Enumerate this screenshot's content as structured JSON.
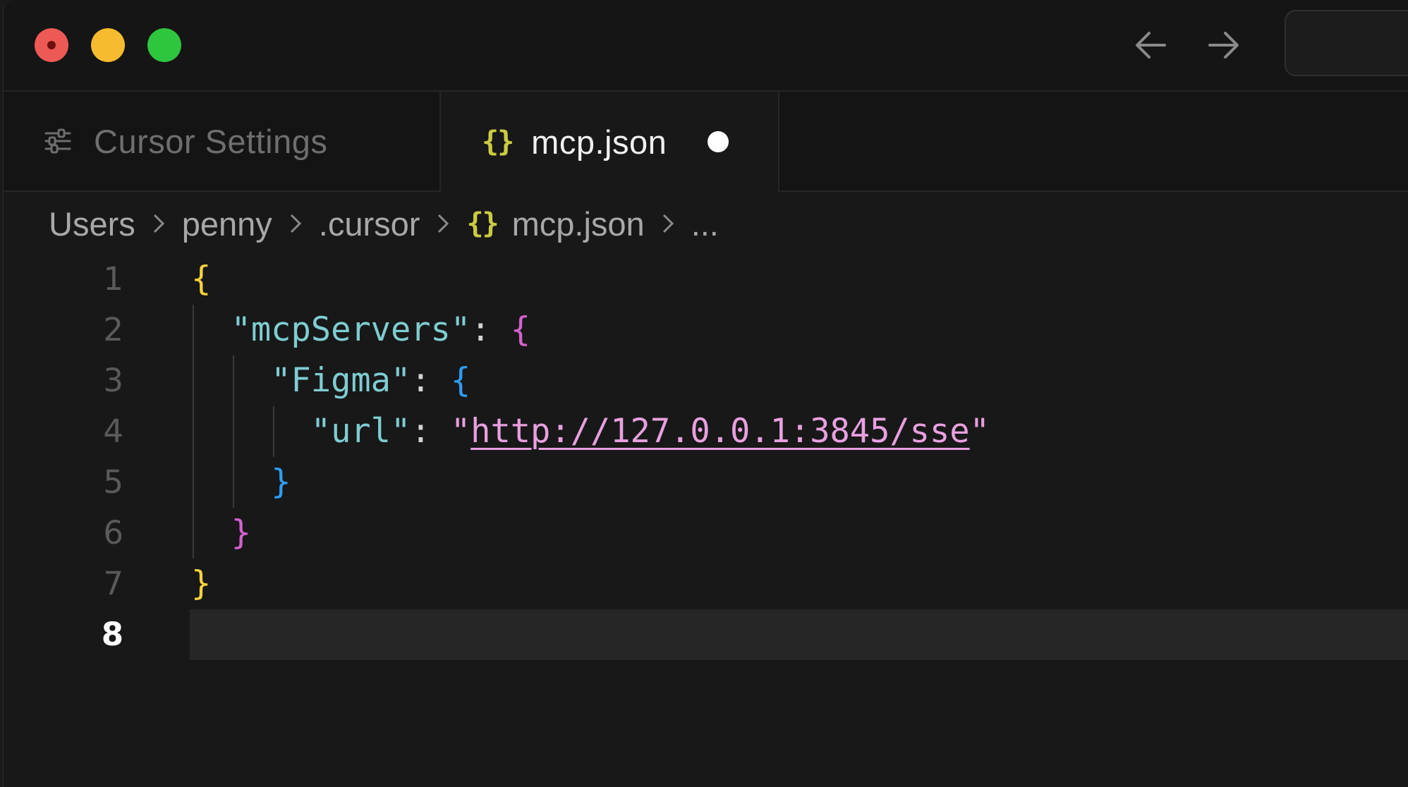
{
  "window": {
    "nav": {
      "back_icon": "arrow-left-icon",
      "forward_icon": "arrow-right-icon"
    }
  },
  "tabs": [
    {
      "label": "Cursor Settings",
      "icon": "sliders-icon",
      "active": false
    },
    {
      "label": "mcp.json",
      "icon": "json-braces-icon",
      "icon_text": "{}",
      "active": true,
      "dirty": true
    }
  ],
  "breadcrumb": {
    "items": [
      "Users",
      "penny",
      ".cursor",
      "mcp.json",
      "..."
    ],
    "file_icon_text": "{}"
  },
  "editor": {
    "line_numbers": [
      "1",
      "2",
      "3",
      "4",
      "5",
      "6",
      "7",
      "8"
    ],
    "current_line": "8",
    "lines": {
      "l1_open": "{",
      "l2_key": "\"mcpServers\"",
      "l2_colon": ": ",
      "l2_open": "{",
      "l3_key": "\"Figma\"",
      "l3_colon": ": ",
      "l3_open": "{",
      "l4_key": "\"url\"",
      "l4_colon": ": ",
      "l4_quote_open": "\"",
      "l4_url": "http://127.0.0.1:3845/sse",
      "l4_quote_close": "\"",
      "l5_close": "}",
      "l6_close": "}",
      "l7_close": "}"
    }
  },
  "colors": {
    "background": "#181818",
    "json_key": "#7ecdd1",
    "bracket_level1": "#f7d33a",
    "bracket_level2": "#d462d0",
    "bracket_level3": "#2e9df5",
    "string": "#e8a0e0",
    "json_icon": "#cbcb41"
  }
}
